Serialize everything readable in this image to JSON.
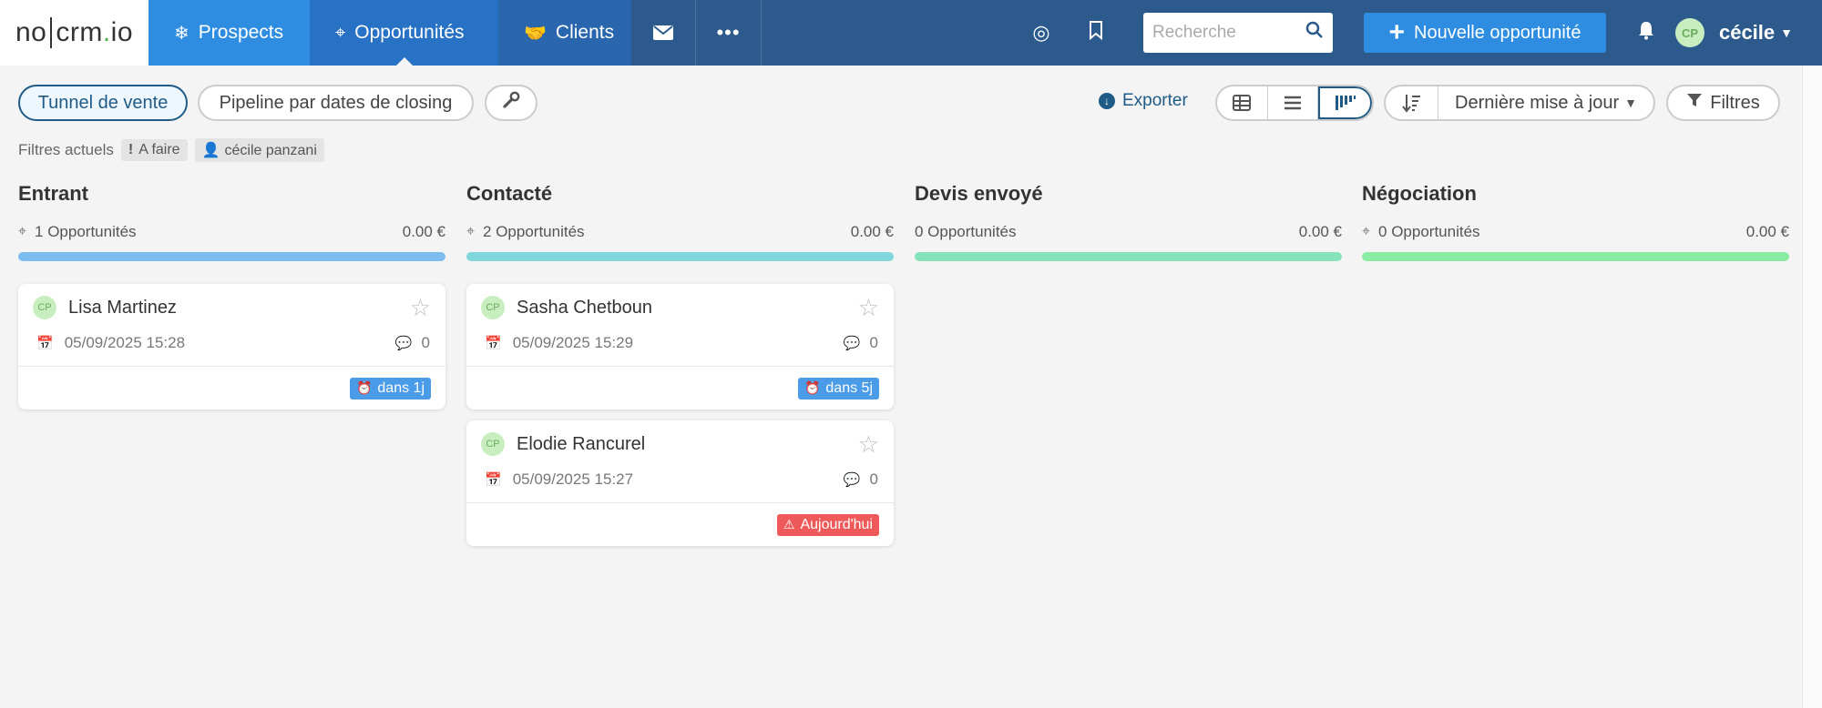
{
  "app": {
    "logo": {
      "a": "no",
      "b": "crm",
      "dot": ".",
      "c": "io"
    },
    "nav": [
      {
        "label": "Prospects",
        "icon": "snowflake-icon"
      },
      {
        "label": "Opportunités",
        "icon": "crosshair-icon"
      },
      {
        "label": "Clients",
        "icon": "handshake-icon"
      }
    ],
    "search_placeholder": "Recherche",
    "new_button": "Nouvelle opportunité",
    "user": {
      "initials": "CP",
      "name": "cécile"
    }
  },
  "toolbar": {
    "pipeline_tabs": [
      "Tunnel de vente",
      "Pipeline par dates de closing"
    ],
    "export": "Exporter",
    "sort_label": "Dernière mise à jour",
    "filters": "Filtres"
  },
  "current_filters": {
    "label": "Filtres actuels",
    "chips": [
      "A faire",
      "cécile panzani"
    ]
  },
  "columns": [
    {
      "title": "Entrant",
      "count": "1 Opportunités",
      "amount": "0.00 €",
      "color": "#7cbdf0",
      "icon": true
    },
    {
      "title": "Contacté",
      "count": "2 Opportunités",
      "amount": "0.00 €",
      "color": "#7fd7dd",
      "icon": true
    },
    {
      "title": "Devis envoyé",
      "count": "0 Opportunités",
      "amount": "0.00 €",
      "color": "#86e3b9",
      "icon": false
    },
    {
      "title": "Négociation",
      "count": "0 Opportunités",
      "amount": "0.00 €",
      "color": "#8aeba3",
      "icon": true
    }
  ],
  "cards": [
    {
      "name": "Lisa Martinez",
      "initials": "CP",
      "date": "05/09/2025 15:28",
      "comments": "0",
      "badge": "dans 1j",
      "badge_color": "blue"
    },
    {
      "name": "Sasha Chetboun",
      "initials": "CP",
      "date": "05/09/2025 15:29",
      "comments": "0",
      "badge": "dans 5j",
      "badge_color": "blue"
    },
    {
      "name": "Elodie Rancurel",
      "initials": "CP",
      "date": "05/09/2025 15:27",
      "comments": "0",
      "badge": "Aujourd'hui",
      "badge_color": "red"
    }
  ]
}
